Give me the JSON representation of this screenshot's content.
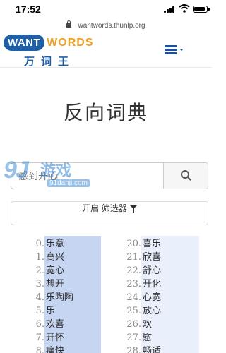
{
  "status_bar": {
    "time": "17:52"
  },
  "browser": {
    "url": "wantwords.thunlp.org"
  },
  "header": {
    "logo_want": "WANT",
    "logo_words": "WORDS",
    "logo_cn": "万词王",
    "menu_icon": "hamburger-menu-icon"
  },
  "page": {
    "title": "反向词典"
  },
  "search": {
    "value": "感到开心",
    "button_icon": "search-icon"
  },
  "watermark": {
    "logo": "9J",
    "name": "游戏",
    "domain": "91danji.com"
  },
  "filter": {
    "label": "开启 筛选器",
    "icon": "funnel-icon"
  },
  "results": {
    "left": [
      {
        "index": "0.",
        "word": "乐意"
      },
      {
        "index": "1.",
        "word": "高兴"
      },
      {
        "index": "2.",
        "word": "宽心"
      },
      {
        "index": "3.",
        "word": "想开"
      },
      {
        "index": "4.",
        "word": "乐陶陶"
      },
      {
        "index": "5.",
        "word": "乐"
      },
      {
        "index": "6.",
        "word": "欢喜"
      },
      {
        "index": "7.",
        "word": "开怀"
      },
      {
        "index": "8.",
        "word": "痛快"
      }
    ],
    "right": [
      {
        "index": "20.",
        "word": "喜乐"
      },
      {
        "index": "21.",
        "word": "欣喜"
      },
      {
        "index": "22.",
        "word": "舒心"
      },
      {
        "index": "23.",
        "word": "开化"
      },
      {
        "index": "24.",
        "word": "心宽"
      },
      {
        "index": "25.",
        "word": "放心"
      },
      {
        "index": "26.",
        "word": "欢"
      },
      {
        "index": "27.",
        "word": "慰"
      },
      {
        "index": "28.",
        "word": "畅适"
      }
    ]
  },
  "colors": {
    "brand_blue": "#1f5fa8",
    "brand_orange": "#f0a020",
    "highlight_left": "#c6d6f2",
    "highlight_right": "#eaf0fb"
  }
}
